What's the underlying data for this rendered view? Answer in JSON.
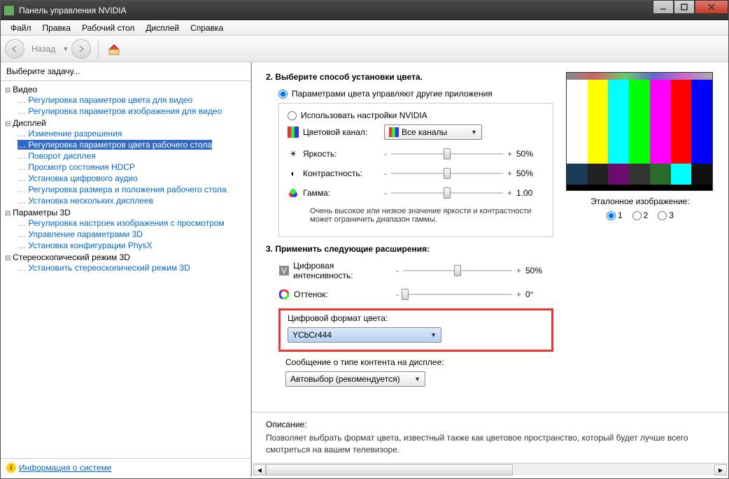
{
  "window": {
    "title": "Панель управления NVIDIA"
  },
  "menu": {
    "file": "Файл",
    "edit": "Правка",
    "desktop": "Рабочий стол",
    "display": "Дисплей",
    "help": "Справка"
  },
  "toolbar": {
    "back": "Назад"
  },
  "sidebar": {
    "header": "Выберите задачу...",
    "groups": {
      "video": "Видео",
      "display": "Дисплей",
      "params3d": "Параметры 3D",
      "stereo": "Стереоскопический режим 3D"
    },
    "items": {
      "v1": "Регулировка параметров цвета для видео",
      "v2": "Регулировка параметров изображения для видео",
      "d1": "Изменение разрешения",
      "d2": "Регулировка параметров цвета рабочего стола",
      "d3": "Поворот дисплея",
      "d4": "Просмотр состояния HDCP",
      "d5": "Установка цифрового аудио",
      "d6": "Регулировка размера и положения рабочего стола",
      "d7": "Установка нескольких дисплеев",
      "p1": "Регулировка настроек изображения с просмотром",
      "p2": "Управление параметрами 3D",
      "p3": "Установка конфигурации PhysX",
      "s1": "Установить стереоскопический режим 3D"
    },
    "sysinfo": "Информация о системе"
  },
  "main": {
    "section2": "2. Выберите способ установки цвета.",
    "radio1": "Параметрами цвета управляют другие приложения",
    "radio2": "Использовать настройки NVIDIA",
    "channel_label": "Цветовой канал:",
    "channel_value": "Все каналы",
    "brightness": "Яркость:",
    "contrast": "Контрастность:",
    "gamma": "Гамма:",
    "b_val": "50%",
    "c_val": "50%",
    "g_val": "1.00",
    "warn": "Очень высокое или низкое значение яркости и контрастности может ограничить диапазон гаммы.",
    "section3": "3. Применить следующие расширения:",
    "dvi": "Цифровая интенсивность:",
    "dvi_val": "50%",
    "hue": "Оттенок:",
    "hue_val": "0°",
    "color_format_label": "Цифровой формат цвета:",
    "color_format_value": "YCbCr444",
    "content_type_label": "Сообщение о типе контента на дисплее:",
    "content_type_value": "Автовыбор (рекомендуется)",
    "preview_label": "Эталонное изображение:",
    "p1": "1",
    "p2": "2",
    "p3": "3",
    "desc_title": "Описание:",
    "desc_body": "Позволяет выбрать формат цвета, известный также как цветовое пространство, который будет лучше всего смотреться на вашем телевизоре."
  }
}
